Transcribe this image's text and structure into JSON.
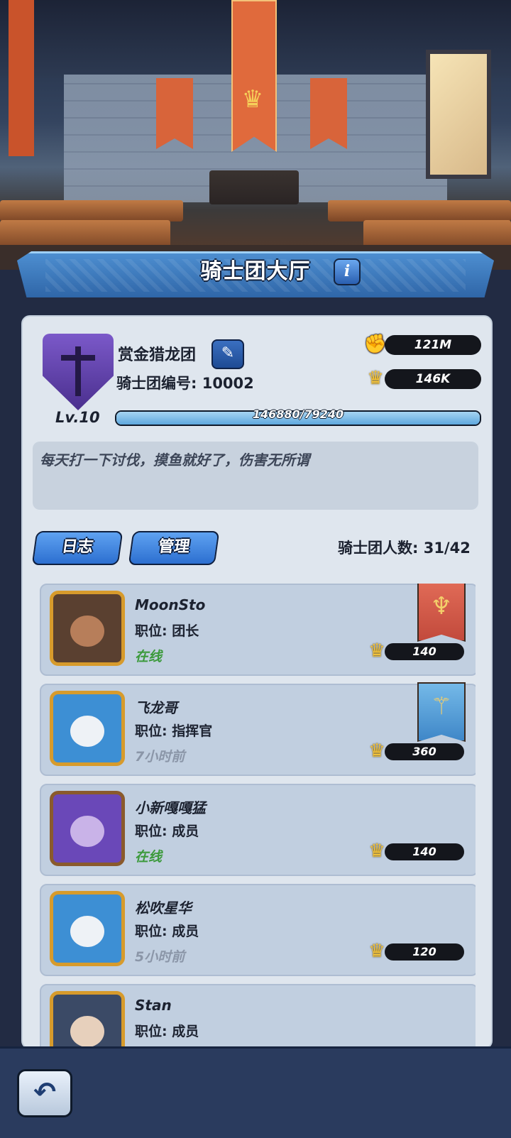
{
  "header": {
    "title": "骑士团大厅",
    "info_label": "i"
  },
  "guild": {
    "name": "赏金猎龙团",
    "id_label": "骑士团编号: 10002",
    "level": "Lv.10",
    "power": "121M",
    "trophies": "146K",
    "xp_text": "146880/79240",
    "xp_progress": 1.0,
    "notice": "每天打一下讨伐，摸鱼就好了，伤害无所谓"
  },
  "tabs": {
    "log": "日志",
    "manage": "管理"
  },
  "member_count": "骑士团人数: 31/42",
  "members": [
    {
      "name": "MoonSto",
      "role": "职位: 团长",
      "status": "在线",
      "online": true,
      "score": "140",
      "flag": "red"
    },
    {
      "name": "飞龙哥",
      "role": "职位: 指挥官",
      "status": "7小时前",
      "online": false,
      "score": "360",
      "flag": "blue"
    },
    {
      "name": "小新嘎嘎猛",
      "role": "职位: 成员",
      "status": "在线",
      "online": true,
      "score": "140"
    },
    {
      "name": "松吹星华",
      "role": "职位: 成员",
      "status": "5小时前",
      "online": false,
      "score": "120"
    },
    {
      "name": "Stan",
      "role": "职位: 成员"
    }
  ],
  "icons": {
    "power": "fist-icon",
    "trophy": "crown-icon",
    "edit": "pencil-icon",
    "back": "back-arrow-icon"
  },
  "colors": {
    "accent": "#2c6fd0",
    "online": "#3c9a3c",
    "offline": "#8b96a8"
  }
}
